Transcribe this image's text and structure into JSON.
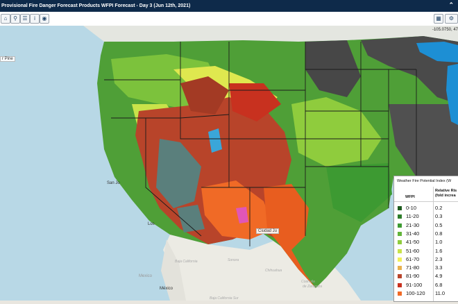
{
  "window": {
    "title": "Provisional Fire Danger Forecast Products WFPI Forecast - Day 3 (Jun 12th, 2021)",
    "collapse_icon": "chevron-up-icon"
  },
  "toolbar": {
    "left_tools": [
      "home-icon",
      "zoom-icon",
      "layers-icon",
      "info-icon",
      "identify-icon"
    ],
    "right_tools": [
      "calendar-icon",
      "settings-icon"
    ]
  },
  "coordinates": "-105.0750, 47",
  "map": {
    "place_labels": {
      "sanjose": "San Jo",
      "la": "Los",
      "ciudad": "Ciudad Ju",
      "mexico": "México",
      "sonora": "Sonora",
      "chihuahua": "Chihuahua",
      "coahuila": "Coahuila",
      "zaragoza": "de Zaragoza",
      "baja": "Baja California",
      "sur": "Baja California Sur",
      "mx_country": "Mexico",
      "pine": "r Pine"
    },
    "colors": {
      "ocean": "#b8d8e6",
      "land_outside": "#ecebe4",
      "no_data": "#4a4a4a",
      "boundary": "#1b1b1b"
    }
  },
  "legend": {
    "title": "Weather Fire Potential Index (W",
    "col_wfpi": "WFPI",
    "col_risk": "Relative Ris\n(fold increa",
    "rows": [
      {
        "range": "0-10",
        "risk": "0.2",
        "color": "#1e5b1e"
      },
      {
        "range": "11-20",
        "risk": "0.3",
        "color": "#2d7d2a"
      },
      {
        "range": "21-30",
        "risk": "0.5",
        "color": "#3d9a32"
      },
      {
        "range": "31-40",
        "risk": "0.8",
        "color": "#62b43a"
      },
      {
        "range": "41-50",
        "risk": "1.0",
        "color": "#8fcc3d"
      },
      {
        "range": "51-60",
        "risk": "1.6",
        "color": "#c9e34a"
      },
      {
        "range": "61-70",
        "risk": "2.3",
        "color": "#f2f05a"
      },
      {
        "range": "71-80",
        "risk": "3.3",
        "color": "#e8b14e"
      },
      {
        "range": "81-90",
        "risk": "4.9",
        "color": "#b8442a"
      },
      {
        "range": "91-100",
        "risk": "6.8",
        "color": "#c8311f"
      },
      {
        "range": "100-120",
        "risk": "11.0",
        "color": "#f06a26"
      }
    ]
  }
}
